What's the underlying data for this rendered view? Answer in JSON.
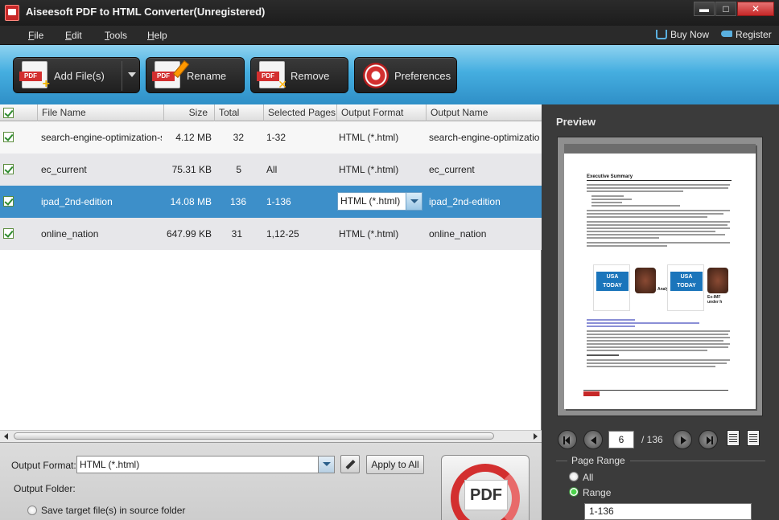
{
  "window": {
    "title": "Aiseesoft PDF to HTML Converter(Unregistered)",
    "minimize": "▬",
    "maximize": "□",
    "close": "✕"
  },
  "menu": {
    "items": [
      {
        "label": "File",
        "accel": "F",
        "rest": "ile"
      },
      {
        "label": "Edit",
        "accel": "E",
        "rest": "dit"
      },
      {
        "label": "Tools",
        "accel": "T",
        "rest": "ools"
      },
      {
        "label": "Help",
        "accel": "H",
        "rest": "elp"
      }
    ],
    "buy_now": "Buy Now",
    "register": "Register"
  },
  "toolbar": {
    "add_files": "Add File(s)",
    "rename": "Rename",
    "remove": "Remove",
    "preferences": "Preferences",
    "pdf_tag": "PDF"
  },
  "table": {
    "columns": [
      "File Name",
      "Size",
      "Total Page",
      "Selected Pages",
      "Output Format",
      "Output Name"
    ],
    "rows": [
      {
        "checked": true,
        "file_name": "search-engine-optimization-s...",
        "size": "4.12 MB",
        "total_page": "32",
        "selected_pages": "1-32",
        "output_format": "HTML (*.html)",
        "output_name": "search-engine-optimization-s..."
      },
      {
        "checked": true,
        "file_name": "ec_current",
        "size": "75.31 KB",
        "total_page": "5",
        "selected_pages": "All",
        "output_format": "HTML (*.html)",
        "output_name": "ec_current"
      },
      {
        "checked": true,
        "file_name": "ipad_2nd-edition",
        "size": "14.08 MB",
        "total_page": "136",
        "selected_pages": "1-136",
        "output_format": "HTML (*.html)",
        "output_name": "ipad_2nd-edition",
        "selected": true
      },
      {
        "checked": true,
        "file_name": "online_nation",
        "size": "647.99 KB",
        "total_page": "31",
        "selected_pages": "1,12-25",
        "output_format": "HTML (*.html)",
        "output_name": "online_nation"
      }
    ]
  },
  "settings": {
    "output_format_label": "Output Format:",
    "output_format_value": "HTML (*.html)",
    "apply_to_all": "Apply to All",
    "output_folder_label": "Output Folder:",
    "save_in_source": "Save target file(s) in source folder",
    "convert_label": "PDF"
  },
  "preview": {
    "title": "Preview",
    "current_page": "6",
    "total_pages": "/ 136",
    "page_range_label": "Page Range",
    "option_all": "All",
    "option_range": "Range",
    "range_value": "1-136",
    "selected_option": "Range",
    "doc_heading": "Executive Summary",
    "thumb_logo_1": "USA TODAY",
    "thumb_logo_2": "USA TODAY",
    "thumb_caption_1": "Analysis aims at c",
    "thumb_caption_2": "Ex-IMF under h"
  },
  "colors": {
    "toolbar_blue": "#45aee0",
    "selected_row": "#3d8fc9",
    "close_red": "#c62828"
  }
}
